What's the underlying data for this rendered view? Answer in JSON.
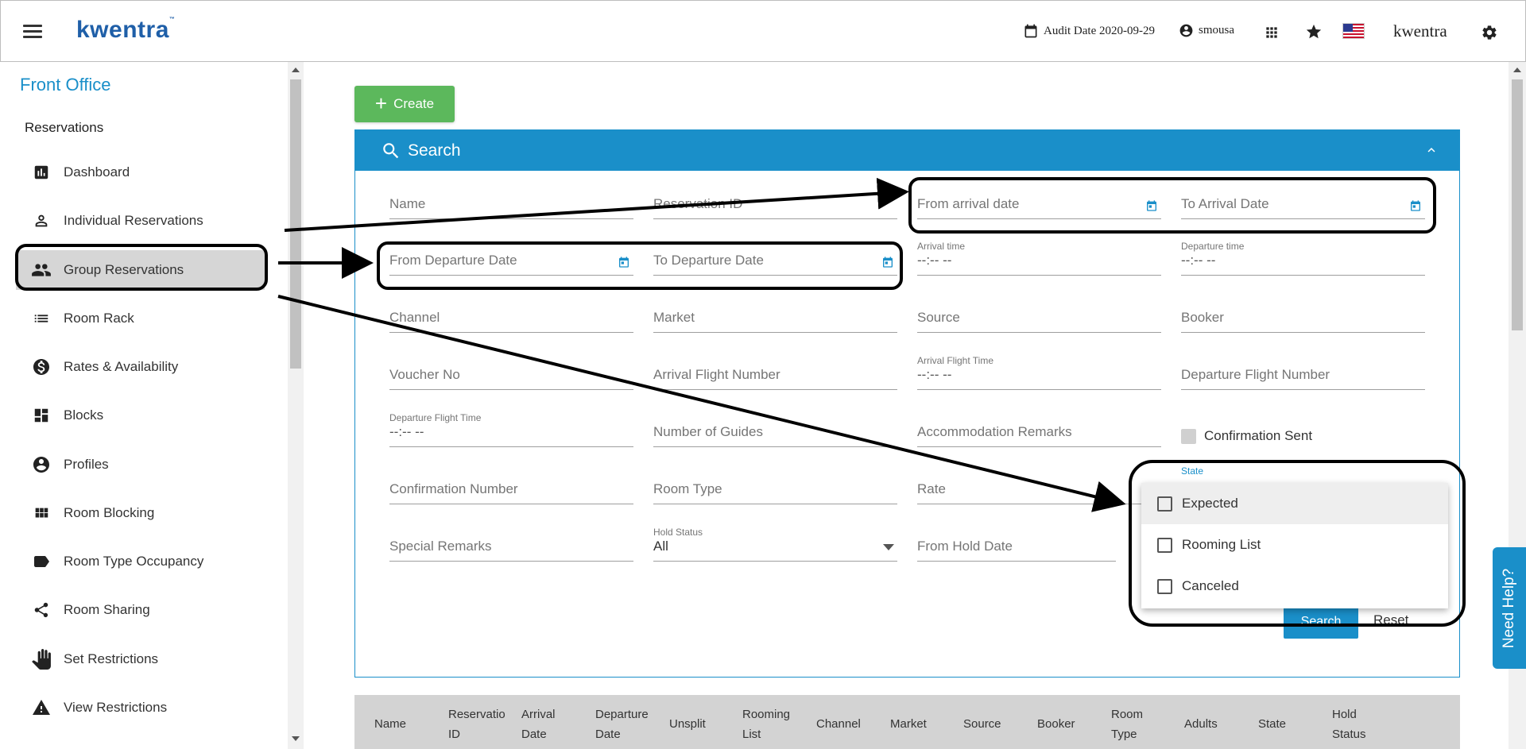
{
  "header": {
    "brand": "kwentra",
    "audit_date": "Audit Date 2020-09-29",
    "user": "smousa",
    "brand_right": "kwentra"
  },
  "sidebar": {
    "title": "Front Office",
    "section": "Reservations",
    "items": [
      {
        "label": "Dashboard",
        "icon": "chart-icon"
      },
      {
        "label": "Individual Reservations",
        "icon": "person-icon"
      },
      {
        "label": "Group Reservations",
        "icon": "group-icon"
      },
      {
        "label": "Room Rack",
        "icon": "list-icon"
      },
      {
        "label": "Rates & Availability",
        "icon": "dollar-icon"
      },
      {
        "label": "Blocks",
        "icon": "dashboard-icon"
      },
      {
        "label": "Profiles",
        "icon": "account-icon"
      },
      {
        "label": "Room Blocking",
        "icon": "grid-icon"
      },
      {
        "label": "Room Type Occupancy",
        "icon": "label-icon"
      },
      {
        "label": "Room Sharing",
        "icon": "share-icon"
      },
      {
        "label": "Set Restrictions",
        "icon": "hand-icon"
      },
      {
        "label": "View Restrictions",
        "icon": "warning-icon"
      }
    ]
  },
  "main": {
    "create_label": "Create",
    "search_title": "Search",
    "fields": {
      "name": "Name",
      "reservation_id": "Reservation ID",
      "from_arrival": "From arrival date",
      "to_arrival": "To Arrival Date",
      "from_departure": "From Departure Date",
      "to_departure": "To Departure Date",
      "arrival_time_label": "Arrival time",
      "arrival_time_value": "--:-- --",
      "departure_time_label": "Departure time",
      "departure_time_value": "--:-- --",
      "channel": "Channel",
      "market": "Market",
      "source": "Source",
      "booker": "Booker",
      "voucher": "Voucher No",
      "arrival_flight_no": "Arrival Flight Number",
      "arrival_flight_time_label": "Arrival Flight Time",
      "arrival_flight_time_value": "--:-- --",
      "departure_flight_no": "Departure Flight Number",
      "departure_flight_time_label": "Departure Flight Time",
      "departure_flight_time_value": "--:-- --",
      "guides": "Number of Guides",
      "accommodation": "Accommodation Remarks",
      "confirmation_sent": "Confirmation Sent",
      "confirmation_no": "Confirmation Number",
      "room_type": "Room Type",
      "rate": "Rate",
      "special_remarks": "Special Remarks",
      "hold_status_label": "Hold Status",
      "hold_status_value": "All",
      "from_hold": "From Hold Date",
      "state_label": "State"
    },
    "state_options": [
      "Expected",
      "Rooming List",
      "Canceled"
    ],
    "search_btn": "Search",
    "reset_btn": "Reset"
  },
  "table": {
    "columns": [
      [
        "Name",
        ""
      ],
      [
        "Reservatio",
        "ID"
      ],
      [
        "Arrival",
        "Date"
      ],
      [
        "Departure",
        "Date"
      ],
      [
        "Unsplit",
        ""
      ],
      [
        "Rooming",
        "List"
      ],
      [
        "Channel",
        ""
      ],
      [
        "Market",
        ""
      ],
      [
        "Source",
        ""
      ],
      [
        "Booker",
        ""
      ],
      [
        "Room",
        "Type"
      ],
      [
        "Adults",
        ""
      ],
      [
        "State",
        ""
      ],
      [
        "Hold",
        "Status"
      ]
    ]
  },
  "help_label": "Need Help?",
  "colors": {
    "accent": "#1a8fc9",
    "create": "#5cb85c",
    "brand": "#1f5fa8"
  }
}
